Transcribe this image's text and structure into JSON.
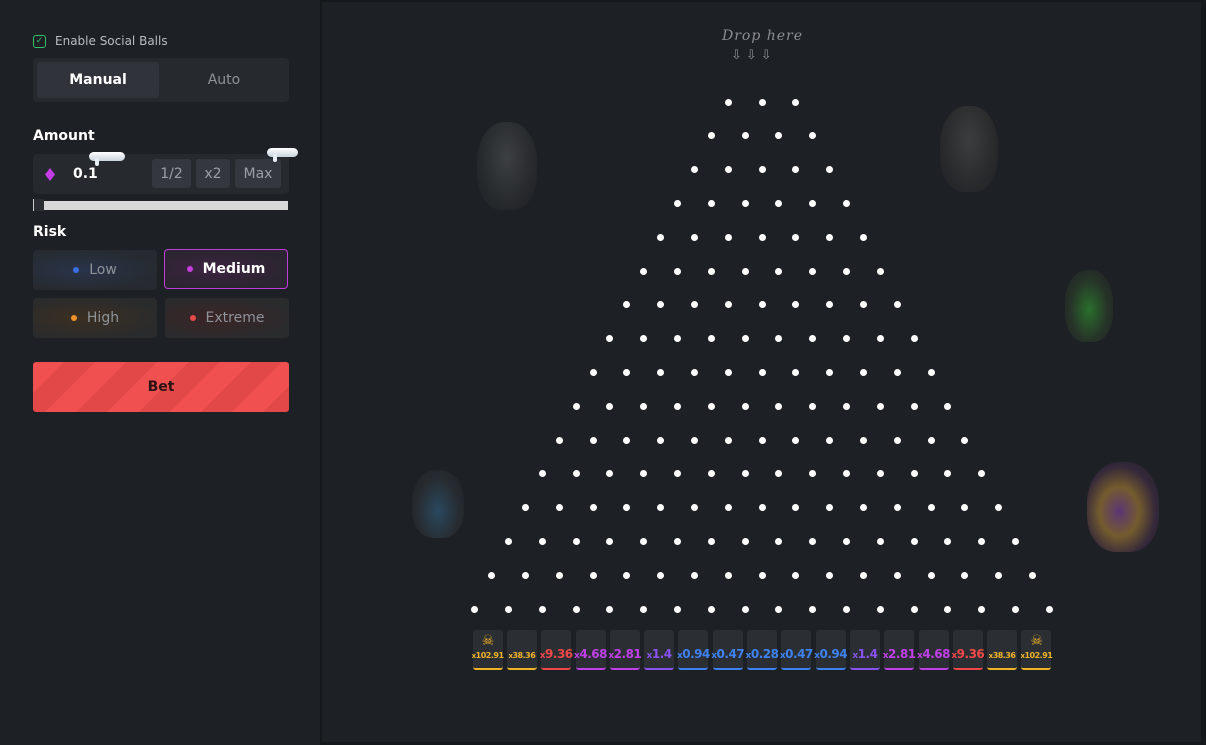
{
  "sidebar": {
    "social_balls": {
      "label": "Enable Social Balls",
      "checked": true
    },
    "mode_tabs": [
      {
        "label": "Manual",
        "active": true
      },
      {
        "label": "Auto",
        "active": false
      }
    ],
    "amount": {
      "label": "Amount",
      "value": "0.1",
      "currency_icon": "gem-icon",
      "buttons": [
        "1/2",
        "x2",
        "Max"
      ],
      "slider_level": 0
    },
    "risk": {
      "label": "Risk",
      "options": [
        {
          "label": "Low",
          "color": "#3b6fe0",
          "selected": false
        },
        {
          "label": "Medium",
          "color": "#c83fe0",
          "selected": true
        },
        {
          "label": "High",
          "color": "#f0902a",
          "selected": false
        },
        {
          "label": "Extreme",
          "color": "#e84a4a",
          "selected": false
        }
      ]
    },
    "bet_label": "Bet"
  },
  "board": {
    "drop_label": "Drop here",
    "drop_arrows": "⇩⇩⇩",
    "rows": 16,
    "slots": [
      {
        "x": "x",
        "value": "102.91",
        "skull": true,
        "color": "#f0b429"
      },
      {
        "x": "x",
        "value": "38.36",
        "skull": false,
        "color": "#f0b429"
      },
      {
        "x": "x",
        "value": "9.36",
        "skull": false,
        "color": "#f04848"
      },
      {
        "x": "x",
        "value": "4.68",
        "skull": false,
        "color": "#c03fe8"
      },
      {
        "x": "x",
        "value": "2.81",
        "skull": false,
        "color": "#c03fe8"
      },
      {
        "x": "x",
        "value": "1.4",
        "skull": false,
        "color": "#8a52f0"
      },
      {
        "x": "x",
        "value": "0.94",
        "skull": false,
        "color": "#3d82f0"
      },
      {
        "x": "x",
        "value": "0.47",
        "skull": false,
        "color": "#3d82f0"
      },
      {
        "x": "x",
        "value": "0.28",
        "skull": false,
        "color": "#3d82f0"
      },
      {
        "x": "x",
        "value": "0.47",
        "skull": false,
        "color": "#3d82f0"
      },
      {
        "x": "x",
        "value": "0.94",
        "skull": false,
        "color": "#3d82f0"
      },
      {
        "x": "x",
        "value": "1.4",
        "skull": false,
        "color": "#8a52f0"
      },
      {
        "x": "x",
        "value": "2.81",
        "skull": false,
        "color": "#c03fe8"
      },
      {
        "x": "x",
        "value": "4.68",
        "skull": false,
        "color": "#c03fe8"
      },
      {
        "x": "x",
        "value": "9.36",
        "skull": false,
        "color": "#f04848"
      },
      {
        "x": "x",
        "value": "38.36",
        "skull": false,
        "color": "#f0b429"
      },
      {
        "x": "x",
        "value": "102.91",
        "skull": true,
        "color": "#f0b429"
      }
    ],
    "decorations": [
      "skull-mask-icon",
      "skull-mask-icon",
      "skull-mask-icon",
      "skull-mask-icon",
      "skull-mask-icon"
    ]
  }
}
